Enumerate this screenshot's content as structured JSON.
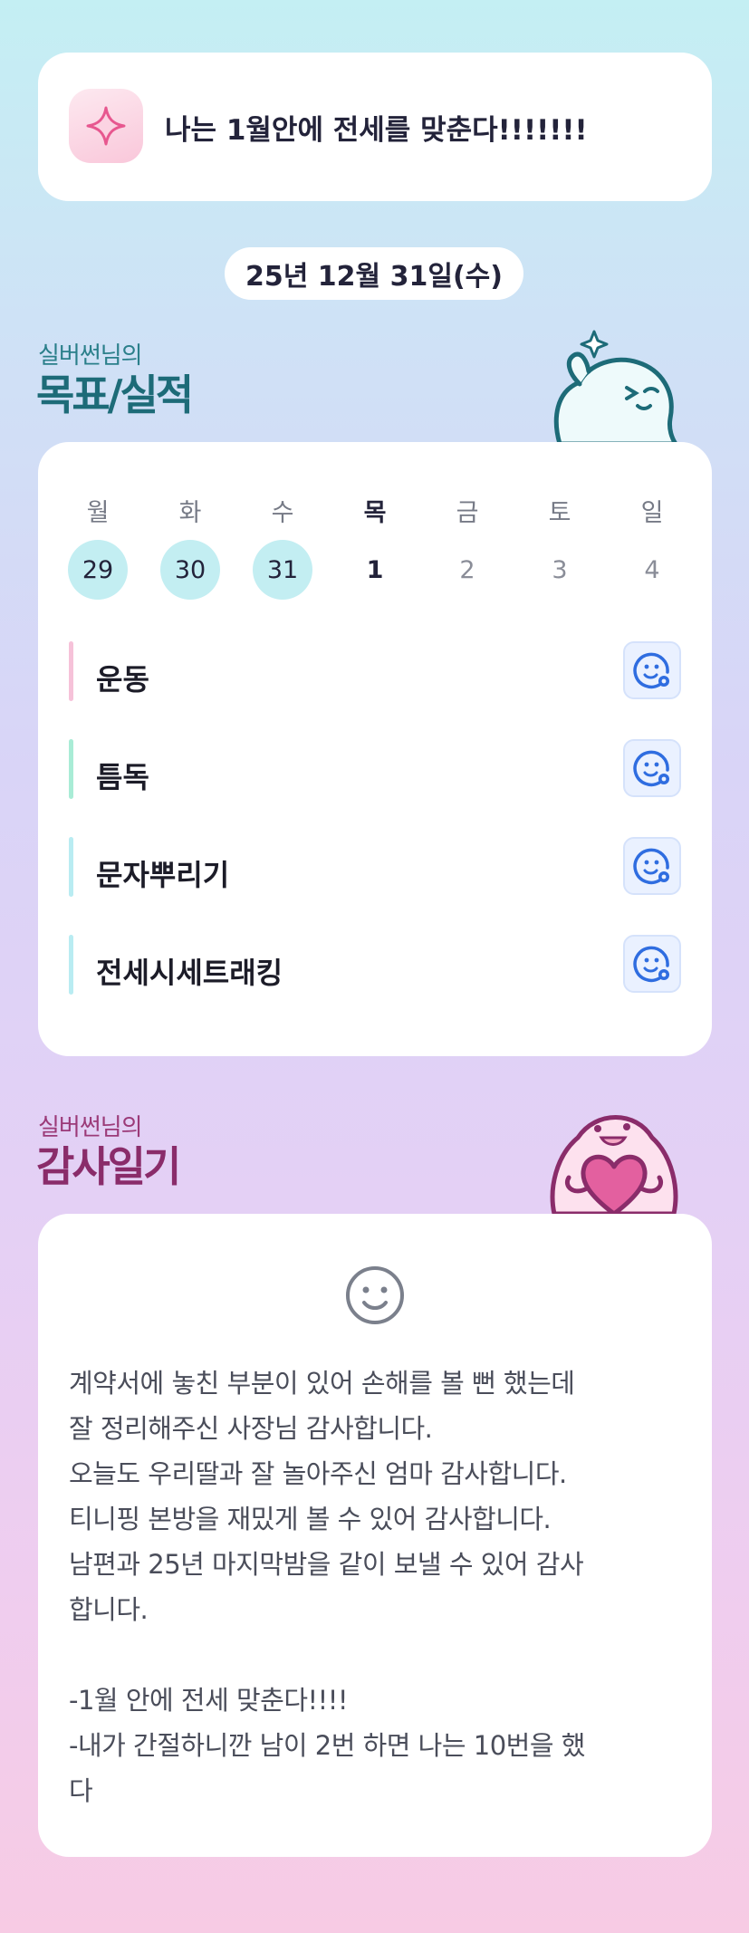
{
  "goal_banner": {
    "icon": "sparkle-icon",
    "text": "나는 1월안에 전세를 맞춘다!!!!!!!"
  },
  "date": "25년 12월 31일(수)",
  "goals_section": {
    "subtitle": "실버썬님의",
    "title": "목표/실적"
  },
  "week": {
    "day_names": [
      "월",
      "화",
      "수",
      "목",
      "금",
      "토",
      "일"
    ],
    "day_numbers": [
      "29",
      "30",
      "31",
      "1",
      "2",
      "3",
      "4"
    ],
    "completed": [
      true,
      true,
      true,
      false,
      false,
      false,
      false
    ],
    "today_index": 3
  },
  "goals": [
    {
      "label": "운동",
      "bar_color": "#f6c2d9",
      "icon": "smiley-settings-icon"
    },
    {
      "label": "틈독",
      "bar_color": "#a9ecd6",
      "icon": "smiley-settings-icon"
    },
    {
      "label": "문자뿌리기",
      "bar_color": "#b9ecf2",
      "icon": "smiley-settings-icon"
    },
    {
      "label": "전세시세트래킹",
      "bar_color": "#b9ecf2",
      "icon": "smiley-settings-icon"
    }
  ],
  "thanks_section": {
    "subtitle": "실버썬님의",
    "title": "감사일기",
    "icon": "smile-face-icon"
  },
  "thanks_body": "계약서에 놓친 부분이 있어 손해를 볼 뻔 했는데\n잘 정리해주신 사장님 감사합니다.\n오늘도 우리딸과 잘 놀아주신 엄마 감사합니다.\n티니핑 본방을 재밌게 볼 수 있어 감사합니다.\n남편과 25년 마지막밤을 같이 보낼 수 있어 감사\n합니다.\n\n-1월 안에 전세 맞춘다!!!!\n-내가 간절하니깐 남이 2번 하면 나는 10번을 했\n다",
  "colors": {
    "accent_blue": "#2f6de0",
    "completed_day": "#c3eef2",
    "goal_title": "#1d6b78",
    "thanks_title": "#8a2c6a"
  }
}
